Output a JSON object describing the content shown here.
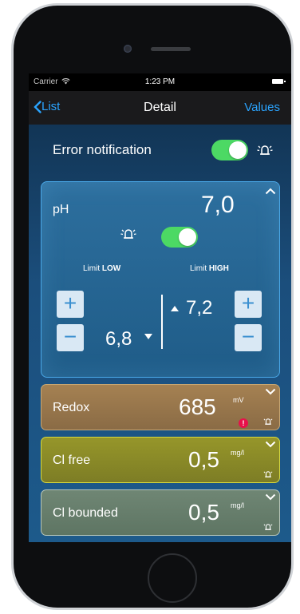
{
  "status_bar": {
    "carrier": "Carrier",
    "time": "1:23 PM",
    "wifi_icon": "wifi-icon",
    "battery_icon": "battery-icon"
  },
  "nav": {
    "back_label": "List",
    "title": "Detail",
    "right_label": "Values",
    "accent": "#2aa4ff"
  },
  "error_notification": {
    "label": "Error notification",
    "toggle_on": true,
    "icon": "alarm-icon"
  },
  "ph_card": {
    "label": "pH",
    "value": "7,0",
    "alarm_toggle_on": true,
    "limit_low_prefix": "Limit",
    "limit_low_label": "LOW",
    "limit_high_prefix": "Limit",
    "limit_high_label": "HIGH",
    "low_value": "6,8",
    "high_value": "7,2",
    "plus": "+",
    "minus": "−"
  },
  "cards": [
    {
      "label": "Redox",
      "value": "685",
      "unit": "mV",
      "warning": "!",
      "color": "#a58152"
    },
    {
      "label": "Cl free",
      "value": "0,5",
      "unit": "mg/l",
      "color": "#96962a"
    },
    {
      "label": "Cl bounded",
      "value": "0,5",
      "unit": "mg/l",
      "color": "#6f8674"
    }
  ],
  "colors": {
    "toggle_on": "#4cd964",
    "warning": "#e8104a"
  }
}
